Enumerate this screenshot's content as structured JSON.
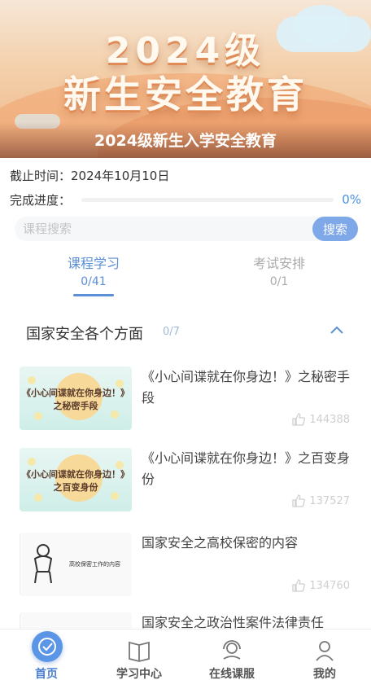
{
  "banner": {
    "line1": "2024级",
    "line2": "新生安全教育",
    "caption": "2024级新生入学安全教育"
  },
  "info": {
    "deadline": "截止时间：2024年10月10日",
    "progress_label": "完成进度：",
    "progress_value": "0%",
    "progress_fraction": 0
  },
  "search": {
    "placeholder": "课程搜索",
    "button_label": "搜索"
  },
  "tabs": [
    {
      "label": "课程学习",
      "count": "0/41",
      "active": true
    },
    {
      "label": "考试安排",
      "count": "0/1",
      "active": false
    }
  ],
  "section": {
    "title": "国家安全各个方面",
    "count": "0/7"
  },
  "courses": [
    {
      "title": "《小心间谍就在你身边！》之秘密手段",
      "likes": "144388",
      "thumb_line1": "《小心间谍就在你身边！》",
      "thumb_line2": "之秘密手段"
    },
    {
      "title": "《小心间谍就在你身边！》之百变身份",
      "likes": "137527",
      "thumb_line1": "《小心间谍就在你身边！》",
      "thumb_line2": "之百变身份"
    },
    {
      "title": "国家安全之高校保密的内容",
      "likes": "134760",
      "thumb_line1": "高校保密工作的内容"
    },
    {
      "title": "国家安全之政治性案件法律责任"
    }
  ],
  "nav": [
    {
      "label": "首页",
      "icon": "home-icon",
      "active": true
    },
    {
      "label": "学习中心",
      "icon": "book-icon",
      "active": false
    },
    {
      "label": "在线课服",
      "icon": "headset-icon",
      "active": false
    },
    {
      "label": "我的",
      "icon": "user-icon",
      "active": false
    }
  ],
  "colors": {
    "accent": "#4a90e2",
    "tab_active": "#5b8fd6",
    "search_button": "#7ea8e8"
  }
}
